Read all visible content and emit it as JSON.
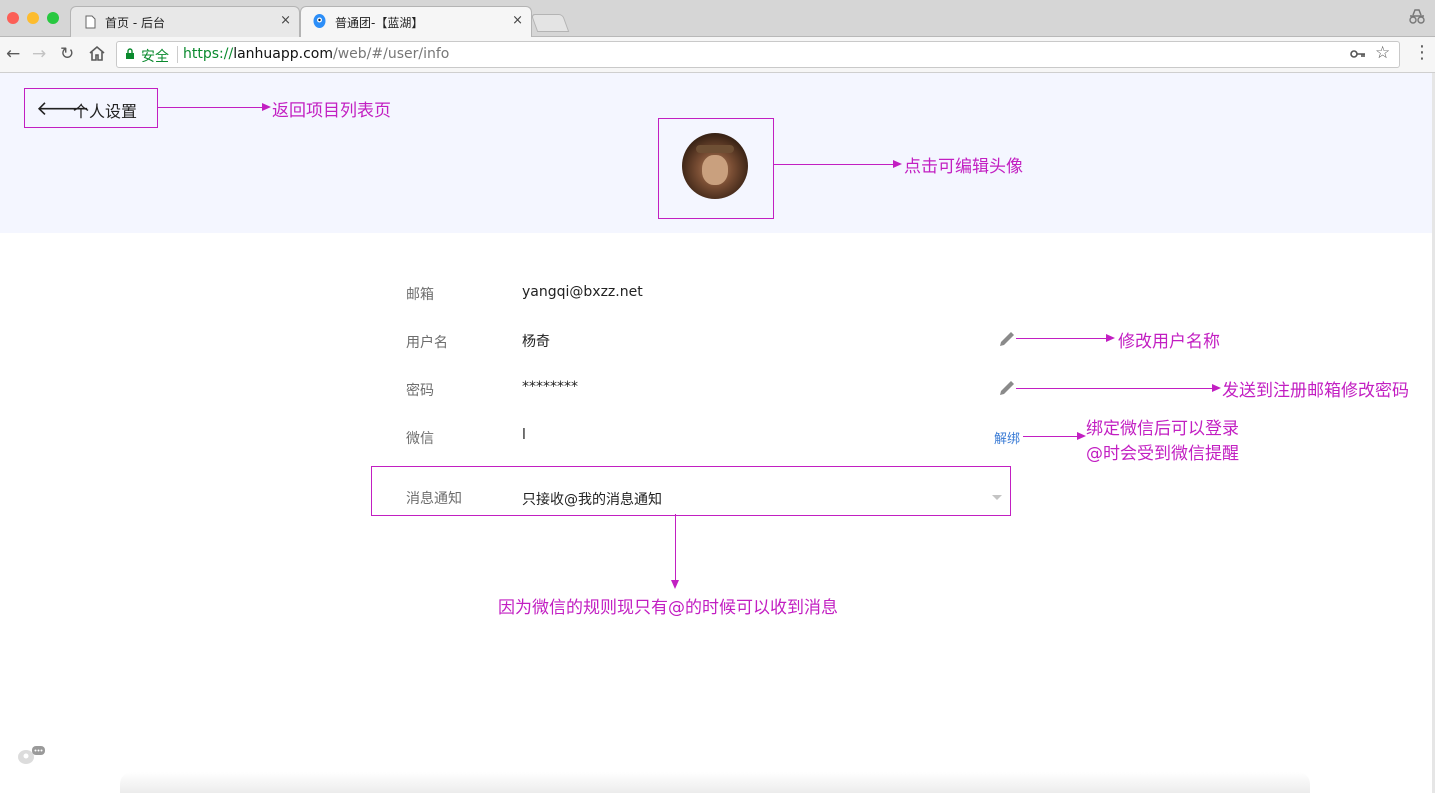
{
  "browser": {
    "tabs": [
      {
        "label": "首页 - 后台",
        "close": "×"
      },
      {
        "label": "普通团-【蓝湖】",
        "close": "×"
      }
    ],
    "address": {
      "secure_label": "安全",
      "scheme": "https://",
      "host": "lanhuapp.com",
      "path": "/web/#/user/info"
    }
  },
  "header": {
    "title": "个人设置"
  },
  "profile": {
    "rows": [
      {
        "label": "邮箱",
        "value": "yangqi@bxzz.net"
      },
      {
        "label": "用户名",
        "value": "杨奇"
      },
      {
        "label": "密码",
        "value": "********"
      },
      {
        "label": "微信",
        "value": "l",
        "action": "解绑"
      }
    ],
    "notification": {
      "label": "消息通知",
      "selected": "只接收@我的消息通知"
    }
  },
  "annotations": {
    "back": "返回项目列表页",
    "avatar": "点击可编辑头像",
    "username": "修改用户名称",
    "password": "发送到注册邮箱修改密码",
    "wechat_line1": "绑定微信后可以登录",
    "wechat_line2": "@时会受到微信提醒",
    "notification": "因为微信的规则现只有@的时候可以收到消息"
  },
  "colors": {
    "annotation": "#c21fc2",
    "link": "#3a7bd5",
    "header_bg": "#f4f6ff"
  }
}
